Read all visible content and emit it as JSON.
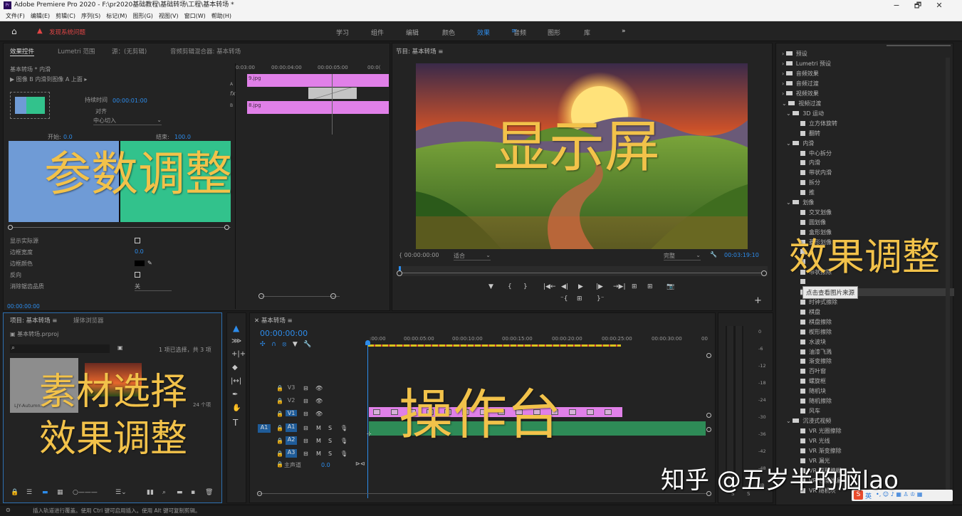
{
  "window": {
    "title": "Adobe Premiere Pro 2020 - F:\\pr2020基础教程\\基础转场\\工程\\基本转场 *",
    "app_icon": "Pr",
    "min": "−",
    "restore": "🗗",
    "close": "✕"
  },
  "menu": [
    "文件(F)",
    "编辑(E)",
    "剪辑(C)",
    "序列(S)",
    "标记(M)",
    "图形(G)",
    "视图(V)",
    "窗口(W)",
    "帮助(H)"
  ],
  "workspace": {
    "alert": "发现系统问题",
    "tabs": [
      "学习",
      "组件",
      "编辑",
      "颜色",
      "效果",
      "音频",
      "图形",
      "库"
    ],
    "active": "效果",
    "more": "»"
  },
  "effect_controls": {
    "tabs": [
      "效果控件",
      "Lumetri 范围",
      "源：(无剪辑)",
      "音频剪辑混合器: 基本转场"
    ],
    "clip_path": "基本转场 * 内滑",
    "desc": "图像 B 内滑到图像 A 上面",
    "duration_label": "持续时间",
    "duration_value": "00:00:01:00",
    "align_label": "对齐",
    "align_value": "中心切入",
    "start_label": "开始:",
    "start_value": "0.0",
    "end_label": "结束:",
    "end_value": "100.0",
    "timecode": "00:00:00:00",
    "mini_times": [
      "0:03:00",
      "00:00:04:00",
      "00:00:05:00",
      "00:0("
    ],
    "clip_a": "9.jpg",
    "clip_b": "8.jpg",
    "fx": "fx",
    "track_a": "A",
    "track_b": "B",
    "props": [
      {
        "label": "显示实际源",
        "value": ""
      },
      {
        "label": "边框宽度",
        "value": "0.0"
      },
      {
        "label": "边框颜色",
        "value": ""
      },
      {
        "label": "反向",
        "value": ""
      },
      {
        "label": "消除锯齿品质",
        "value": "关"
      }
    ]
  },
  "program": {
    "title": "节目: 基本转场",
    "tc_left": "00:00:00:00",
    "fit": "适合",
    "quality": "完整",
    "tc_right": "00:03:19:10",
    "controls": [
      "▼",
      "{",
      "}",
      "|◀←",
      "◀|",
      "▶",
      "|▶",
      "→▶|",
      "⊞",
      "⊞",
      "📷"
    ],
    "row2": [
      "⁻{",
      "⊞",
      "}⁻"
    ],
    "plus": "+"
  },
  "effects_tree": [
    {
      "t": "预设",
      "lvl": 0,
      "k": "folder"
    },
    {
      "t": "Lumetri 预设",
      "lvl": 0,
      "k": "folder"
    },
    {
      "t": "音频效果",
      "lvl": 0,
      "k": "folder"
    },
    {
      "t": "音频过渡",
      "lvl": 0,
      "k": "folder"
    },
    {
      "t": "视频效果",
      "lvl": 0,
      "k": "folder"
    },
    {
      "t": "视频过渡",
      "lvl": 0,
      "k": "folder"
    },
    {
      "t": "3D 运动",
      "lvl": 1,
      "k": "folder"
    },
    {
      "t": "立方体旋转",
      "lvl": 2,
      "k": "fx"
    },
    {
      "t": "翻转",
      "lvl": 2,
      "k": "fx"
    },
    {
      "t": "内滑",
      "lvl": 1,
      "k": "folder"
    },
    {
      "t": "中心拆分",
      "lvl": 2,
      "k": "fx"
    },
    {
      "t": "内滑",
      "lvl": 2,
      "k": "fx"
    },
    {
      "t": "带状内滑",
      "lvl": 2,
      "k": "fx"
    },
    {
      "t": "拆分",
      "lvl": 2,
      "k": "fx"
    },
    {
      "t": "推",
      "lvl": 2,
      "k": "fx"
    },
    {
      "t": "划像",
      "lvl": 1,
      "k": "folder"
    },
    {
      "t": "交叉划像",
      "lvl": 2,
      "k": "fx"
    },
    {
      "t": "圆划像",
      "lvl": 2,
      "k": "fx"
    },
    {
      "t": "盒形划像",
      "lvl": 2,
      "k": "fx"
    },
    {
      "t": "菱形划像",
      "lvl": 2,
      "k": "fx"
    },
    {
      "t": "",
      "lvl": 2,
      "k": "fx"
    },
    {
      "t": "",
      "lvl": 2,
      "k": "fx"
    },
    {
      "t": "带状擦除",
      "lvl": 2,
      "k": "fx"
    },
    {
      "t": "",
      "lvl": 2,
      "k": "fx"
    },
    {
      "t": "插入",
      "lvl": 2,
      "k": "fx"
    },
    {
      "t": "时钟式擦除",
      "lvl": 2,
      "k": "fx"
    },
    {
      "t": "棋盘",
      "lvl": 2,
      "k": "fx"
    },
    {
      "t": "棋盘擦除",
      "lvl": 2,
      "k": "fx"
    },
    {
      "t": "楔形擦除",
      "lvl": 2,
      "k": "fx"
    },
    {
      "t": "水波块",
      "lvl": 2,
      "k": "fx"
    },
    {
      "t": "油漆飞溅",
      "lvl": 2,
      "k": "fx"
    },
    {
      "t": "渐变擦除",
      "lvl": 2,
      "k": "fx"
    },
    {
      "t": "百叶窗",
      "lvl": 2,
      "k": "fx"
    },
    {
      "t": "螺旋框",
      "lvl": 2,
      "k": "fx"
    },
    {
      "t": "随机块",
      "lvl": 2,
      "k": "fx"
    },
    {
      "t": "随机擦除",
      "lvl": 2,
      "k": "fx"
    },
    {
      "t": "风车",
      "lvl": 2,
      "k": "fx"
    },
    {
      "t": "沉浸式视频",
      "lvl": 1,
      "k": "folder"
    },
    {
      "t": "VR 光圈擦除",
      "lvl": 2,
      "k": "fx"
    },
    {
      "t": "VR 光线",
      "lvl": 2,
      "k": "fx"
    },
    {
      "t": "VR 渐变擦除",
      "lvl": 2,
      "k": "fx"
    },
    {
      "t": "VR 漏光",
      "lvl": 2,
      "k": "fx"
    },
    {
      "t": "VR 球形模糊",
      "lvl": 2,
      "k": "fx"
    },
    {
      "t": "VR 色度泄漏",
      "lvl": 2,
      "k": "fx"
    },
    {
      "t": "VR 随机块",
      "lvl": 2,
      "k": "fx"
    }
  ],
  "tooltip": "点击查看图片来源",
  "project": {
    "tabs": [
      "项目: 基本转场",
      "媒体浏览器"
    ],
    "file": "基本转场.prproj",
    "count": "1 项已选择，共 3 项",
    "thumb1": "LJY-Autumn...",
    "thumb2_info": "24 个项"
  },
  "timeline": {
    "title": "基本转场",
    "timecode": "00:00:00:00",
    "ruler": [
      ":00:00",
      "00:00:05:00",
      "00:00:10:00",
      "00:00:15:00",
      "00:00:20:00",
      "00:00:25:00",
      "00:00:30:00",
      "00"
    ],
    "video_tracks": [
      "V3",
      "V2",
      "V1"
    ],
    "audio_tracks": [
      "A1",
      "A2",
      "A3"
    ],
    "master": "主声道",
    "master_val": "0.0",
    "src_a1": "A1"
  },
  "meter": {
    "scale": [
      "0",
      "-6",
      "-12",
      "-18",
      "-24",
      "-30",
      "-36",
      "-42",
      "-48",
      "dB"
    ],
    "lr": [
      "S",
      "S"
    ]
  },
  "status": "插入轨道进行覆盖。使用 Ctrl 键可启用插入。使用 Alt 键可复制剪辑。",
  "overlays": {
    "params": "参数调整",
    "display": "显示屏",
    "effects": "效果调整",
    "material": "素材选择",
    "material2": "效果调整",
    "console": "操作台"
  },
  "watermark": "知乎 @五岁半的脑lao",
  "ime": "英",
  "colors": {
    "accent_blue": "#2d8ceb",
    "clip_pink": "#e080e8",
    "audio_green": "#2e8b57",
    "overlay_gold": "#f2c24a",
    "alert_red": "#e14545",
    "slide_blue": "#6f9bd6",
    "slide_green": "#32c28c"
  }
}
